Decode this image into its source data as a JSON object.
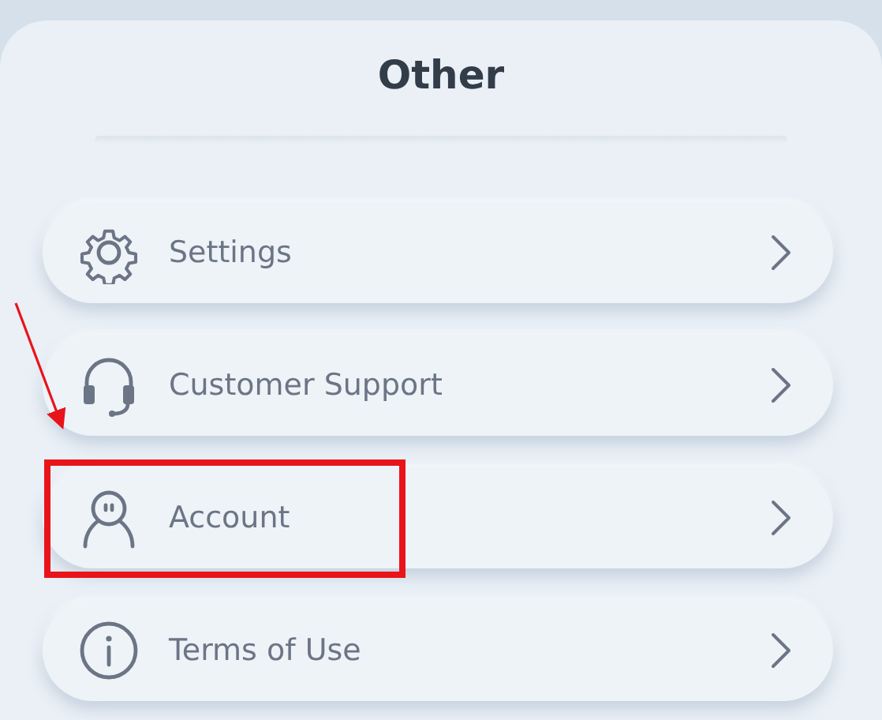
{
  "panel": {
    "title": "Other"
  },
  "items": [
    {
      "kind": "settings",
      "label": "Settings",
      "highlighted": false
    },
    {
      "kind": "support",
      "label": "Customer Support",
      "highlighted": false
    },
    {
      "kind": "account",
      "label": "Account",
      "highlighted": true
    },
    {
      "kind": "info",
      "label": "Terms of Use",
      "highlighted": false
    }
  ]
}
